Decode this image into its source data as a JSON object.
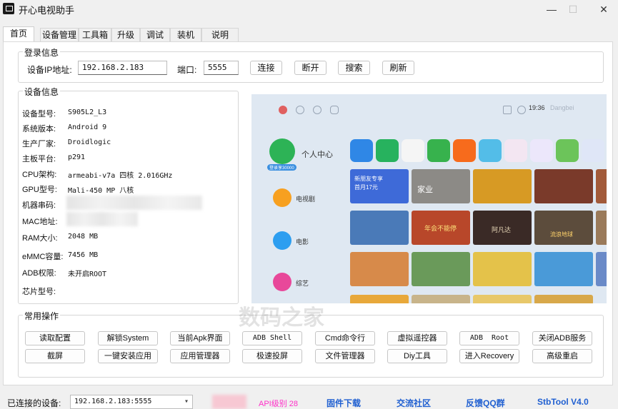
{
  "window": {
    "title": "开心电视助手",
    "min": "—",
    "max": "☐",
    "close": "✕"
  },
  "tabs": [
    "首页",
    "设备管理",
    "工具箱",
    "升级",
    "调试",
    "装机",
    "说明"
  ],
  "login": {
    "title": "登录信息",
    "ip_label": "设备IP地址:",
    "ip_value": "192.168.2.183",
    "port_label": "端口:",
    "port_value": "5555",
    "buttons": [
      "连接",
      "断开",
      "搜索",
      "刷新"
    ]
  },
  "device_info": {
    "title": "设备信息",
    "rows": [
      {
        "label": "设备型号:",
        "value": "S905L2_L3"
      },
      {
        "label": "系统版本:",
        "value": "Android 9"
      },
      {
        "label": "生产厂家:",
        "value": "Droidlogic"
      },
      {
        "label": "主板平台:",
        "value": "p291"
      },
      {
        "label": "CPU架构:",
        "value": "armeabi-v7a 四核 2.016GHz"
      },
      {
        "label": "GPU型号:",
        "value": "Mali-450 MP 八核"
      },
      {
        "label": "机器串码:",
        "value": ""
      },
      {
        "label": "MAC地址:",
        "value": ""
      },
      {
        "label": "RAM大小:",
        "value": "2048 MB"
      },
      {
        "label": "eMMC容量:",
        "value": "7456 MB"
      },
      {
        "label": "ADB权限:",
        "value": "未开启ROOT"
      },
      {
        "label": "芯片型号:",
        "value": ""
      }
    ]
  },
  "tv_screen": {
    "time": "19:36",
    "brand": "Dangbei",
    "menu": [
      {
        "label": "个人中心",
        "badge": "登录享30000"
      },
      {
        "label": "电视剧"
      },
      {
        "label": "电影"
      },
      {
        "label": "综艺"
      }
    ],
    "promo": [
      "新朋友专享",
      "首月17元"
    ],
    "tile_text": [
      "家业",
      "年会不能停",
      "阿凡达",
      "流浪地球"
    ]
  },
  "common_ops": {
    "title": "常用操作",
    "buttons": [
      "读取配置",
      "解锁System",
      "当前Apk界面",
      "ADB Shell",
      "Cmd命令行",
      "虚拟遥控器",
      "ADB  Root",
      "关闭ADB服务",
      "截屏",
      "一键安装应用",
      "应用管理器",
      "极速投屏",
      "文件管理器",
      "Diy工具",
      "进入Recovery",
      "高级重启"
    ]
  },
  "watermark": "数码之家",
  "status": {
    "label": "已连接的设备:",
    "device": "192.168.2.183:5555",
    "api_level": "API级别 28",
    "links": [
      "固件下载",
      "交流社区",
      "反馈QQ群",
      "StbTool V4.0"
    ]
  },
  "colors": {
    "api_level": "#ff2ec8",
    "links": "#1f5fd1",
    "tv_background": "#dfe8f2"
  }
}
